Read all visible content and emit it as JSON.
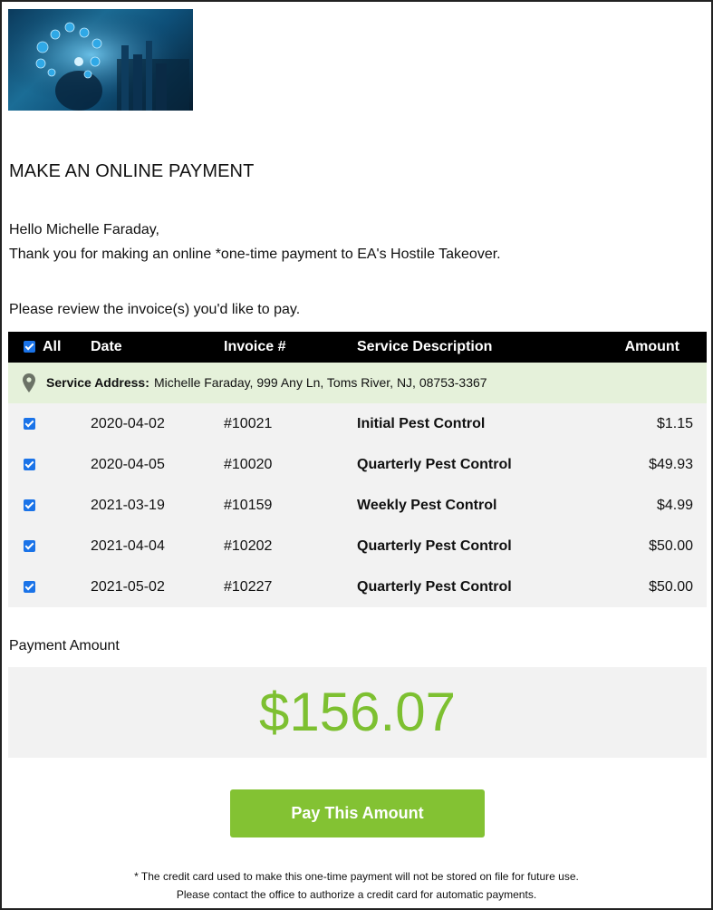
{
  "page": {
    "title": "MAKE AN ONLINE PAYMENT",
    "greeting": "Hello Michelle Faraday,",
    "thanks": "Thank you for making an online *one-time payment to EA's Hostile Takeover.",
    "review": "Please review the invoice(s) you'd like to pay."
  },
  "hero": {
    "icon": "technology-banner-image"
  },
  "table": {
    "headers": {
      "all": "All",
      "date": "Date",
      "invoice": "Invoice #",
      "service": "Service Description",
      "amount": "Amount"
    },
    "address_label": "Service Address:",
    "address_value": "Michelle Faraday, 999 Any Ln, Toms River, NJ, 08753-3367",
    "rows": [
      {
        "checked": true,
        "date": "2020-04-02",
        "invoice": "#10021",
        "service": "Initial Pest Control",
        "amount": "$1.15"
      },
      {
        "checked": true,
        "date": "2020-04-05",
        "invoice": "#10020",
        "service": "Quarterly Pest Control",
        "amount": "$49.93"
      },
      {
        "checked": true,
        "date": "2021-03-19",
        "invoice": "#10159",
        "service": "Weekly Pest Control",
        "amount": "$4.99"
      },
      {
        "checked": true,
        "date": "2021-04-04",
        "invoice": "#10202",
        "service": "Quarterly Pest Control",
        "amount": "$50.00"
      },
      {
        "checked": true,
        "date": "2021-05-02",
        "invoice": "#10227",
        "service": "Quarterly Pest Control",
        "amount": "$50.00"
      }
    ]
  },
  "payment": {
    "label": "Payment Amount",
    "amount": "$156.07",
    "button": "Pay This Amount",
    "note1": "* The credit card used to make this one-time payment will not be stored on file for future use.",
    "note2": "Please contact the office to authorize a credit card for automatic payments."
  },
  "colors": {
    "accent": "#83c233",
    "amount_text": "#7dc031",
    "address_bg": "#e5f1da",
    "header_bg": "#000000"
  }
}
